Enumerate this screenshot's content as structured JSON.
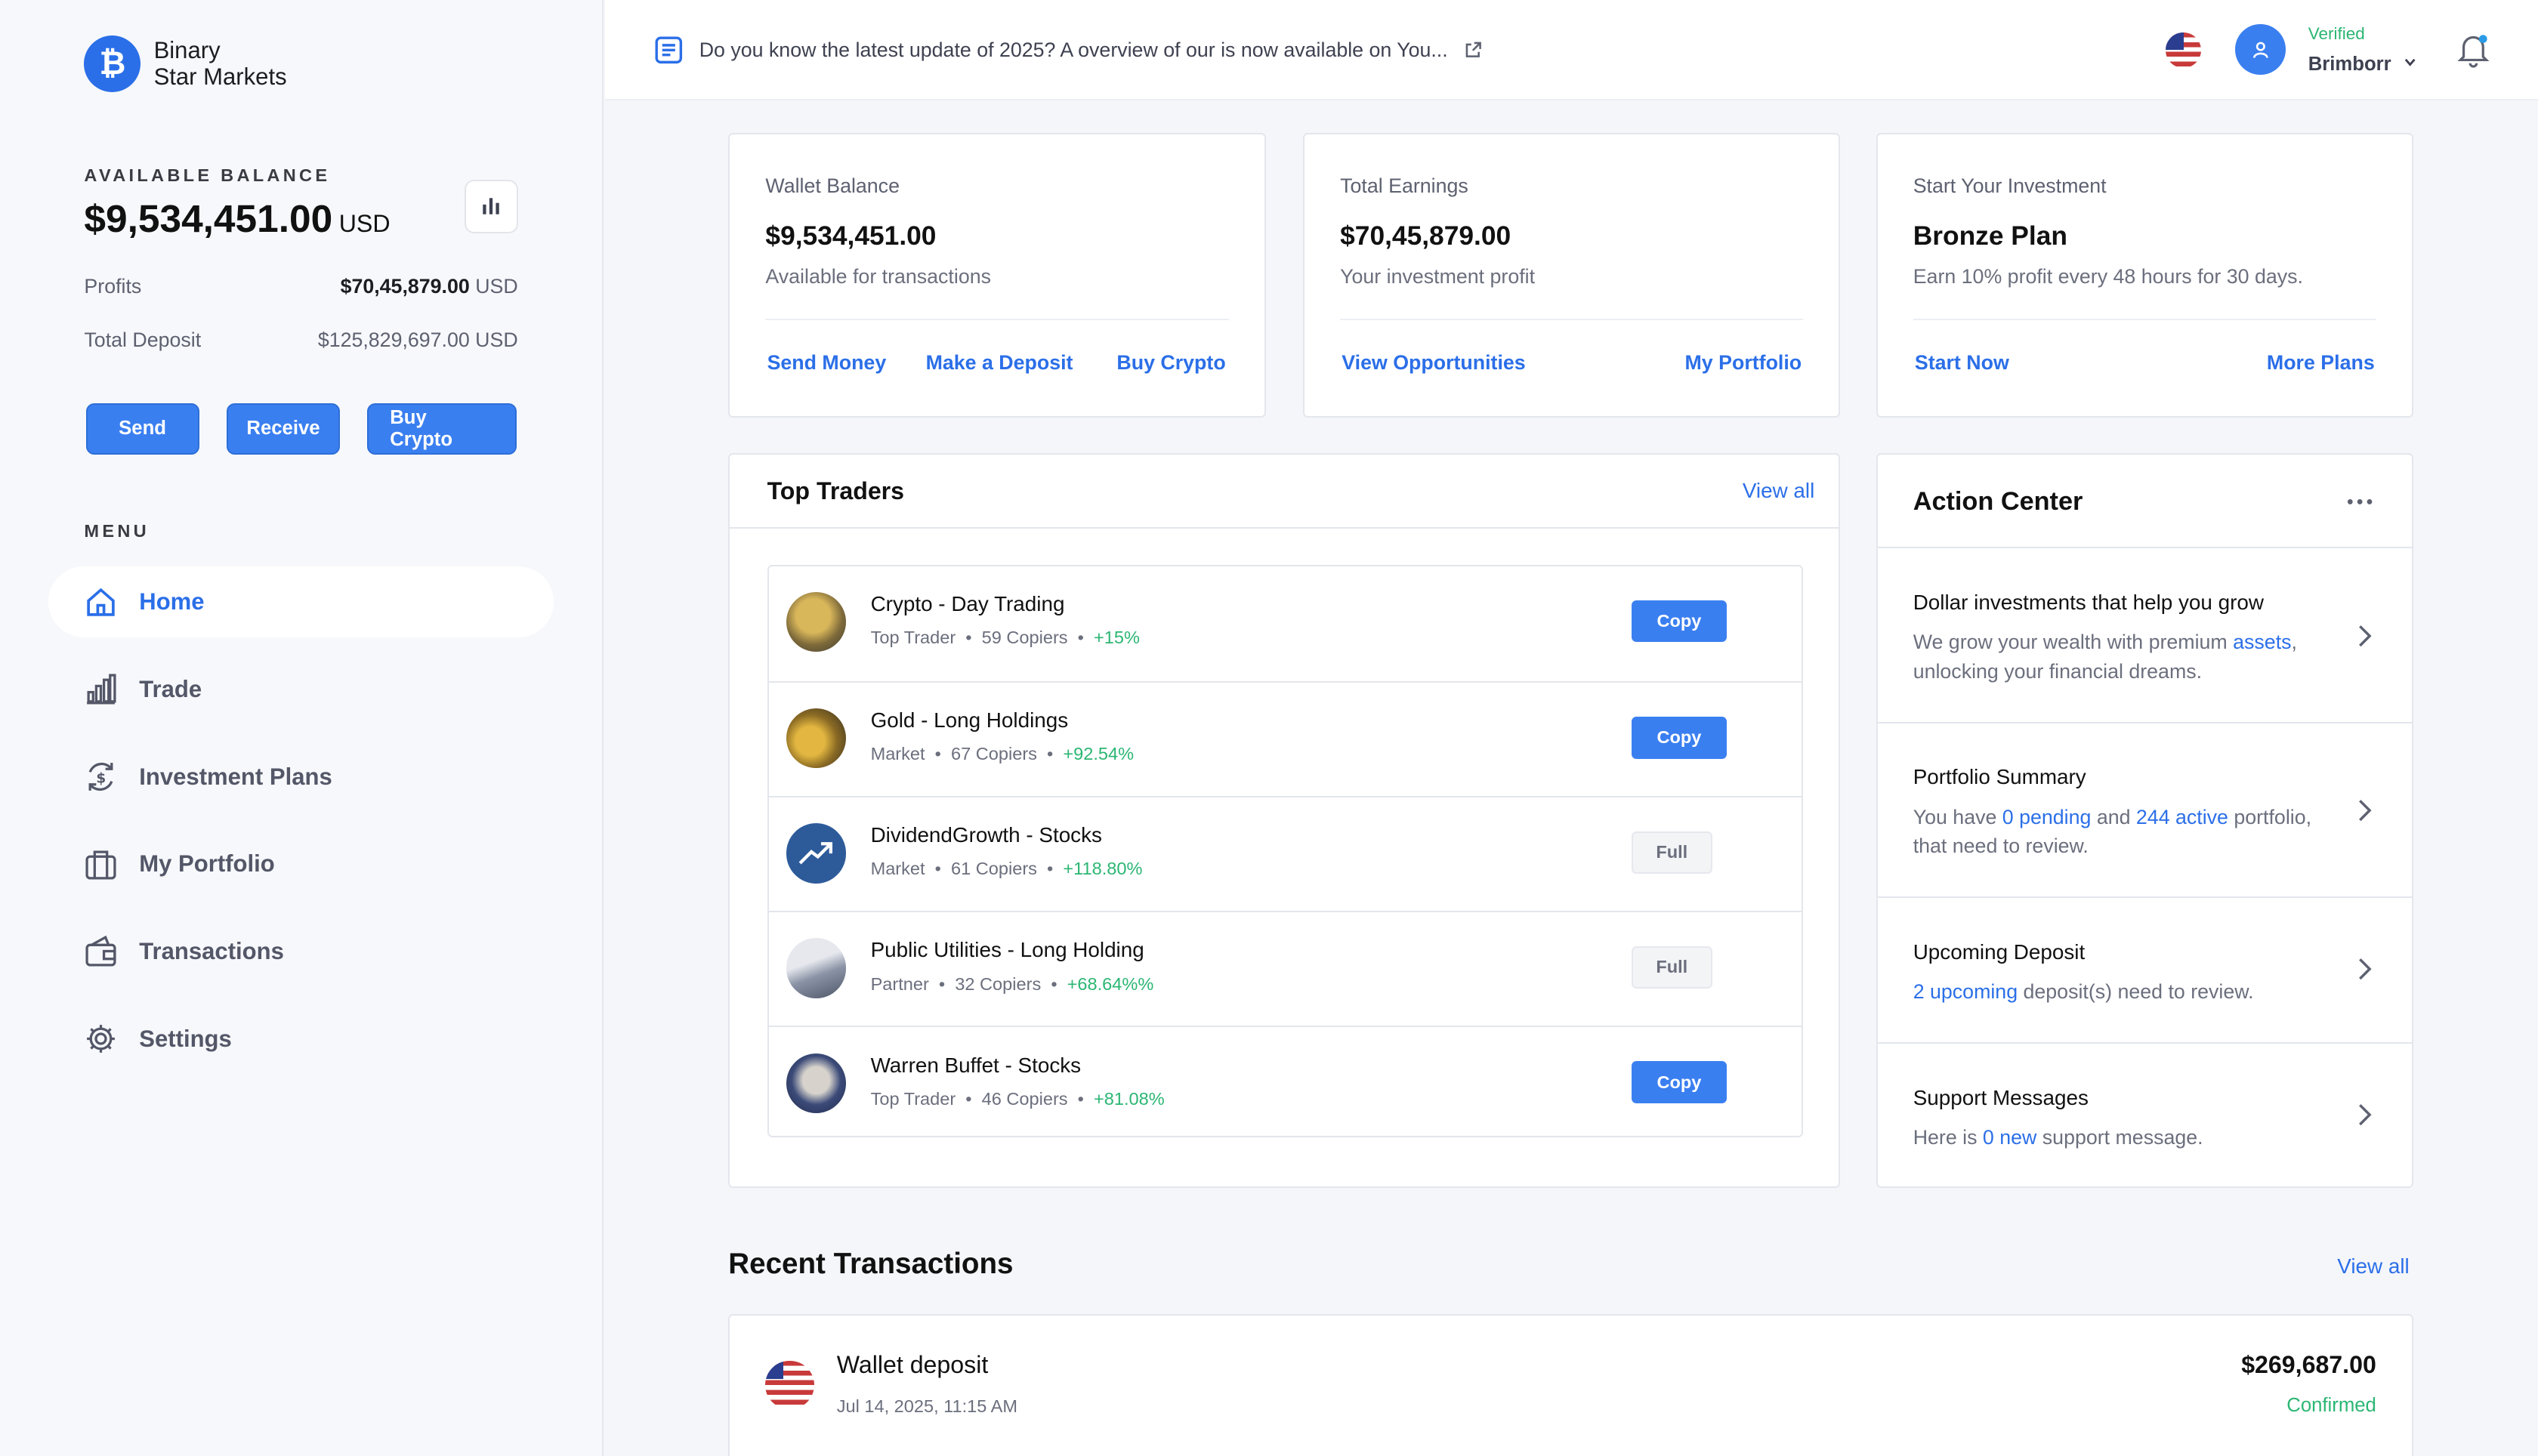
{
  "brand": {
    "line1": "Binary",
    "line2": "Star Markets",
    "logo": "bitcoin-icon"
  },
  "balance": {
    "label": "AVAILABLE BALANCE",
    "amount": "$9,534,451.00",
    "currency": "USD",
    "profits_label": "Profits",
    "profits_value": "$70,45,879.00",
    "profits_cur": "USD",
    "deposit_label": "Total Deposit",
    "deposit_value": "$125,829,697.00 USD"
  },
  "actions": {
    "send": "Send",
    "receive": "Receive",
    "buy": "Buy Crypto"
  },
  "menu": {
    "label": "MENU",
    "items": [
      {
        "label": "Home",
        "icon": "home-icon"
      },
      {
        "label": "Trade",
        "icon": "bar-chart-icon"
      },
      {
        "label": "Investment Plans",
        "icon": "exchange-icon"
      },
      {
        "label": "My Portfolio",
        "icon": "briefcase-icon"
      },
      {
        "label": "Transactions",
        "icon": "wallet-icon"
      },
      {
        "label": "Settings",
        "icon": "gear-icon"
      }
    ]
  },
  "topbar": {
    "news": "Do you know the latest update of 2025? A overview of our is now available on You...",
    "verified": "Verified",
    "username": "Brimborr"
  },
  "cards": {
    "wallet": {
      "label": "Wallet Balance",
      "value": "$9,534,451.00",
      "sub": "Available for transactions",
      "l1": "Send Money",
      "l2": "Make a Deposit",
      "l3": "Buy Crypto"
    },
    "earnings": {
      "label": "Total Earnings",
      "value": "$70,45,879.00",
      "sub": "Your investment profit",
      "l1": "View Opportunities",
      "l2": "My Portfolio"
    },
    "invest": {
      "label": "Start Your Investment",
      "value": "Bronze Plan",
      "sub": "Earn 10% profit every 48 hours for 30 days.",
      "l1": "Start Now",
      "l2": "More Plans"
    }
  },
  "traders": {
    "title": "Top Traders",
    "view_all": "View all",
    "rows": [
      {
        "name": "Crypto - Day Trading",
        "role": "Top Trader",
        "copiers": "59 Copiers",
        "gain": "+15%",
        "btn": "Copy"
      },
      {
        "name": "Gold - Long Holdings",
        "role": "Market",
        "copiers": "67 Copiers",
        "gain": "+92.54%",
        "btn": "Copy"
      },
      {
        "name": "DividendGrowth - Stocks",
        "role": "Market",
        "copiers": "61 Copiers",
        "gain": "+118.80%",
        "btn": "Full"
      },
      {
        "name": "Public Utilities - Long Holding",
        "role": "Partner",
        "copiers": "32 Copiers",
        "gain": "+68.64%%",
        "btn": "Full"
      },
      {
        "name": "Warren Buffet - Stocks",
        "role": "Top Trader",
        "copiers": "46 Copiers",
        "gain": "+81.08%",
        "btn": "Copy"
      }
    ]
  },
  "action_center": {
    "title": "Action Center",
    "i1": {
      "title": "Dollar investments that help you grow",
      "a": "We grow your wealth with premium ",
      "hl": "assets",
      "b": ", unlocking your financial dreams."
    },
    "i2": {
      "title": "Portfolio Summary",
      "a": "You have ",
      "hl1": "0 pending",
      "m": " and ",
      "hl2": "244 active",
      "b": " portfolio, that need to review."
    },
    "i3": {
      "title": "Upcoming Deposit",
      "hl": "2 upcoming",
      "b": " deposit(s) need to review."
    },
    "i4": {
      "title": "Support Messages",
      "a": "Here is ",
      "hl": "0 new",
      "b": " support message."
    }
  },
  "recent": {
    "title": "Recent Transactions",
    "view_all": "View all",
    "tx": {
      "title": "Wallet deposit",
      "date": "Jul 14, 2025, 11:15 AM",
      "amount": "$269,687.00",
      "status": "Confirmed"
    }
  },
  "colors": {
    "accent": "#2b6fe8",
    "button": "#3a7ff0",
    "positive": "#2bb673"
  }
}
